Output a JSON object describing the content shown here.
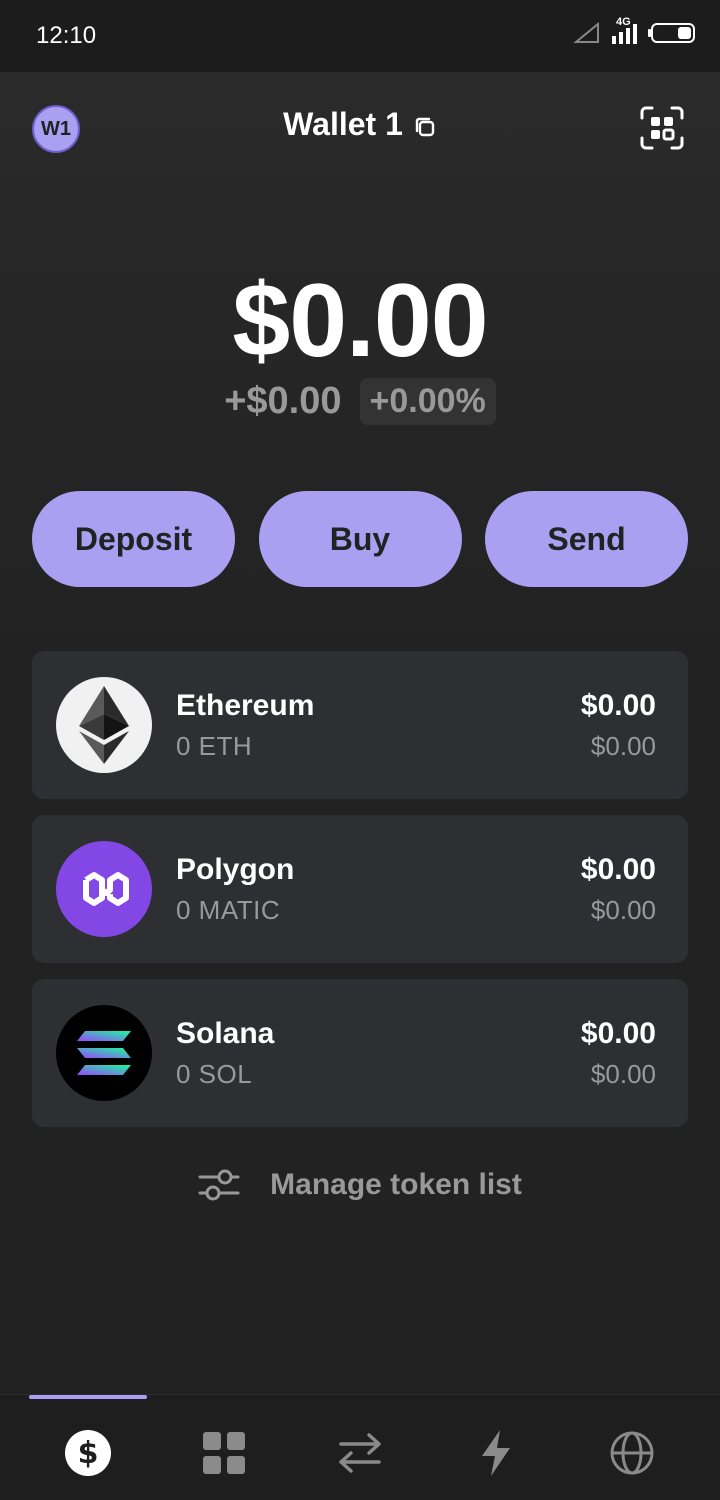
{
  "status_bar": {
    "time": "12:10",
    "network": "4G"
  },
  "header": {
    "avatar_initials": "W1",
    "wallet_name": "Wallet 1",
    "icons": {
      "copy": "copy-icon",
      "scan": "qr-scan-icon"
    }
  },
  "balance": {
    "total": "$0.00",
    "change_amount": "+$0.00",
    "change_percent": "+0.00%"
  },
  "actions": [
    {
      "label": "Deposit"
    },
    {
      "label": "Buy"
    },
    {
      "label": "Send"
    }
  ],
  "tokens": [
    {
      "name": "Ethereum",
      "amount": "0 ETH",
      "value": "$0.00",
      "sub_value": "$0.00",
      "icon": "ethereum-icon"
    },
    {
      "name": "Polygon",
      "amount": "0 MATIC",
      "value": "$0.00",
      "sub_value": "$0.00",
      "icon": "polygon-icon"
    },
    {
      "name": "Solana",
      "amount": "0 SOL",
      "value": "$0.00",
      "sub_value": "$0.00",
      "icon": "solana-icon"
    }
  ],
  "manage": {
    "label": "Manage token list",
    "icon": "sliders-icon"
  },
  "bottom_nav": {
    "items": [
      {
        "name": "wallet",
        "icon": "dollar-icon",
        "active": true
      },
      {
        "name": "collectibles",
        "icon": "grid-icon",
        "active": false
      },
      {
        "name": "swap",
        "icon": "swap-arrows-icon",
        "active": false
      },
      {
        "name": "activity",
        "icon": "lightning-icon",
        "active": false
      },
      {
        "name": "browser",
        "icon": "globe-icon",
        "active": false
      }
    ]
  },
  "colors": {
    "accent": "#ab9ff2",
    "background": "#222222",
    "card": "#2e2f33",
    "muted_text": "#999999",
    "polygon": "#8247e5"
  }
}
